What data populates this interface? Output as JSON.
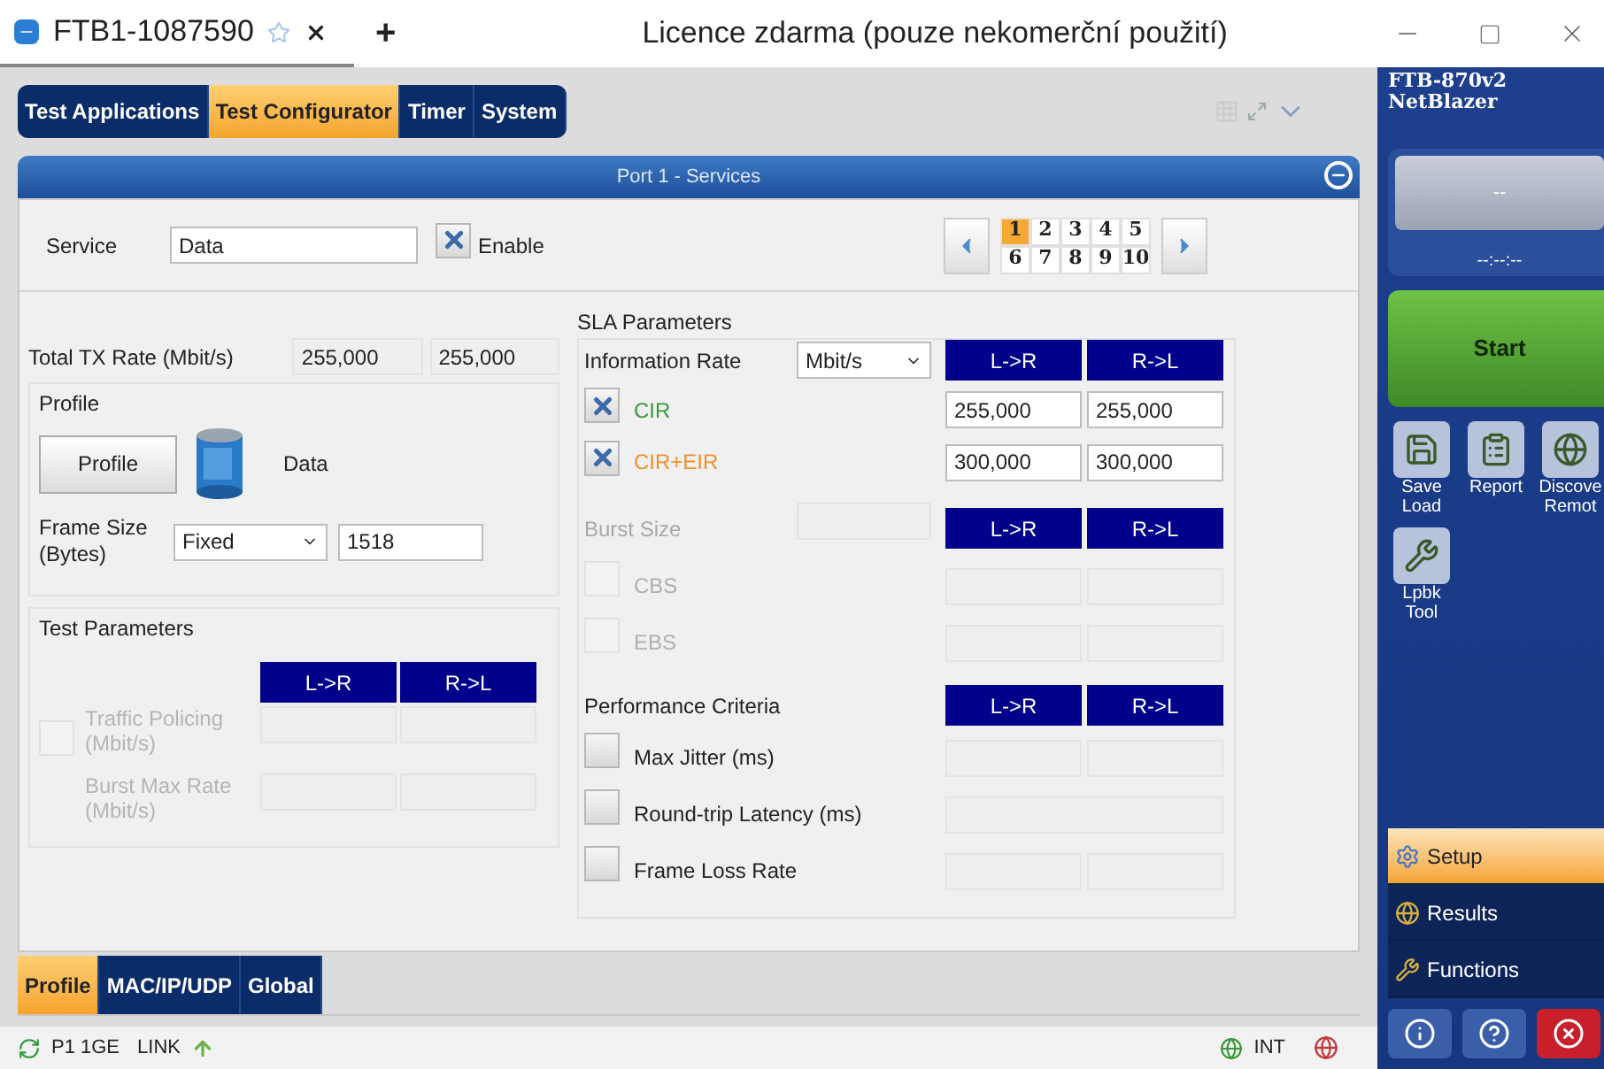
{
  "title_bar": {
    "tab_title": "FTB1-1087590",
    "new_tab": "+",
    "license": "Licence zdarma (pouze nekomerční použití)"
  },
  "top_tabs": [
    {
      "label": "Test Applications",
      "selected": false
    },
    {
      "label": "Test Configurator",
      "selected": true
    },
    {
      "label": "Timer",
      "selected": false
    },
    {
      "label": "System",
      "selected": false
    }
  ],
  "panel_title": "Port 1 - Services",
  "service": {
    "label": "Service",
    "value": "Data",
    "enable": {
      "label": "Enable",
      "checked": true
    }
  },
  "pages": [
    {
      "label": "1",
      "selected": true
    },
    {
      "label": "2",
      "selected": false
    },
    {
      "label": "3",
      "selected": false
    },
    {
      "label": "4",
      "selected": false
    },
    {
      "label": "5",
      "selected": false
    },
    {
      "label": "6",
      "selected": false
    },
    {
      "label": "7",
      "selected": false
    },
    {
      "label": "8",
      "selected": false
    },
    {
      "label": "9",
      "selected": false
    },
    {
      "label": "10",
      "selected": false
    }
  ],
  "total_tx": {
    "label": "Total TX Rate (Mbit/s)",
    "values": [
      "255,000",
      "255,000"
    ]
  },
  "profile": {
    "title": "Profile",
    "button": "Profile",
    "name": "Data",
    "frame_size_label": "Frame Size (Bytes)",
    "frame_mode": "Fixed",
    "frame_value": "1518"
  },
  "test_parameters": {
    "title": "Test Parameters",
    "headers": [
      "L->R",
      "R->L"
    ],
    "rows": [
      {
        "kind": "checkbox",
        "label": "Traffic Policing (Mbit/s)",
        "checked": false,
        "disabled": true
      },
      {
        "kind": "plain",
        "label": "Burst Max Rate (Mbit/s)",
        "disabled": true
      }
    ]
  },
  "sla": {
    "title": "SLA Parameters",
    "sections": [
      {
        "label": "Information Rate",
        "unit": "Mbit/s",
        "disabled": false,
        "headers": [
          "L->R",
          "R->L"
        ],
        "rows": [
          {
            "kind": "pair",
            "label": "CIR",
            "checked": true,
            "disabled": false,
            "color": "#3c9a3c",
            "values": [
              "255,000",
              "255,000"
            ]
          },
          {
            "kind": "pair",
            "label": "CIR+EIR",
            "checked": true,
            "disabled": false,
            "color": "#f0902c",
            "values": [
              "300,000",
              "300,000"
            ]
          }
        ]
      },
      {
        "label": "Burst Size",
        "disabled": true,
        "headers": [
          "L->R",
          "R->L"
        ],
        "rows": [
          {
            "kind": "pair",
            "label": "CBS",
            "checked": false,
            "disabled": true
          },
          {
            "kind": "pair",
            "label": "EBS",
            "checked": false,
            "disabled": true
          }
        ]
      },
      {
        "label": "Performance Criteria",
        "disabled": false,
        "headers": [
          "L->R",
          "R->L"
        ],
        "rows": [
          {
            "kind": "pair",
            "label": "Max Jitter (ms)",
            "checked": false,
            "disabled": false
          },
          {
            "kind": "single",
            "label": "Round-trip Latency (ms)",
            "checked": false,
            "disabled": false
          },
          {
            "kind": "pair",
            "label": "Frame Loss Rate",
            "checked": false,
            "disabled": false
          }
        ]
      }
    ]
  },
  "bottom_tabs": [
    {
      "label": "Profile",
      "selected": true
    },
    {
      "label": "MAC/IP/UDP",
      "selected": false
    },
    {
      "label": "Global",
      "selected": false
    }
  ],
  "status_bar": {
    "port": "P1 1GE",
    "link": "LINK",
    "clock": "INT"
  },
  "sidebar": {
    "model": [
      "FTB-870v2",
      "NetBlazer"
    ],
    "display": "--",
    "time": "--:--:--",
    "start": "Start",
    "tools": [
      {
        "kind": "save",
        "lines": [
          "Save",
          "Load"
        ]
      },
      {
        "kind": "report",
        "lines": [
          "Report"
        ]
      },
      {
        "kind": "discover",
        "lines": [
          "Discove",
          "Remot"
        ]
      },
      {
        "kind": "loopback",
        "lines": [
          "Lpbk",
          "Tool"
        ]
      }
    ],
    "nav": [
      {
        "kind": "setup",
        "label": "Setup",
        "selected": true
      },
      {
        "kind": "results",
        "label": "Results",
        "selected": false
      },
      {
        "kind": "functions",
        "label": "Functions",
        "selected": false
      }
    ]
  }
}
